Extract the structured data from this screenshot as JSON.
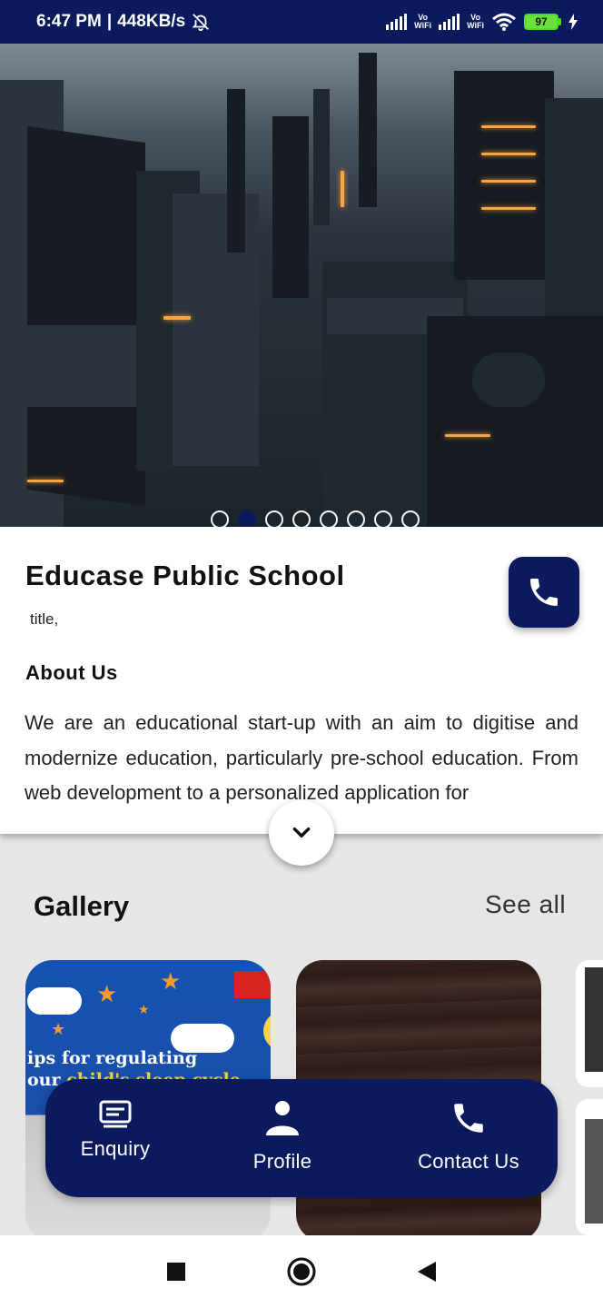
{
  "status_bar": {
    "time": "6:47 PM",
    "speed": "448KB/s",
    "vowifi_1": "Vo\nWiFi",
    "vowifi_2": "Vo\nWiFi",
    "battery": "97"
  },
  "hero": {
    "slide_count": 8,
    "active_slide": 2
  },
  "school": {
    "name": "Educase Public School",
    "subtitle": "title,"
  },
  "about": {
    "heading": "About Us",
    "text": "We are an educational start-up with an aim to digitise and modernize education, particularly pre-school education. From web development to a personalized application for"
  },
  "gallery": {
    "title": "Gallery",
    "see_all": "See all",
    "card1_caption_line1": "ips for regulating",
    "card1_caption_line2a": "our ",
    "card1_caption_line2b": "child's sleep cycle"
  },
  "bottom_nav": {
    "enquiry": "Enquiry",
    "profile": "Profile",
    "contact": "Contact Us"
  },
  "colors": {
    "primary": "#0a1a5c",
    "active_dot": "#0a1a5c"
  }
}
